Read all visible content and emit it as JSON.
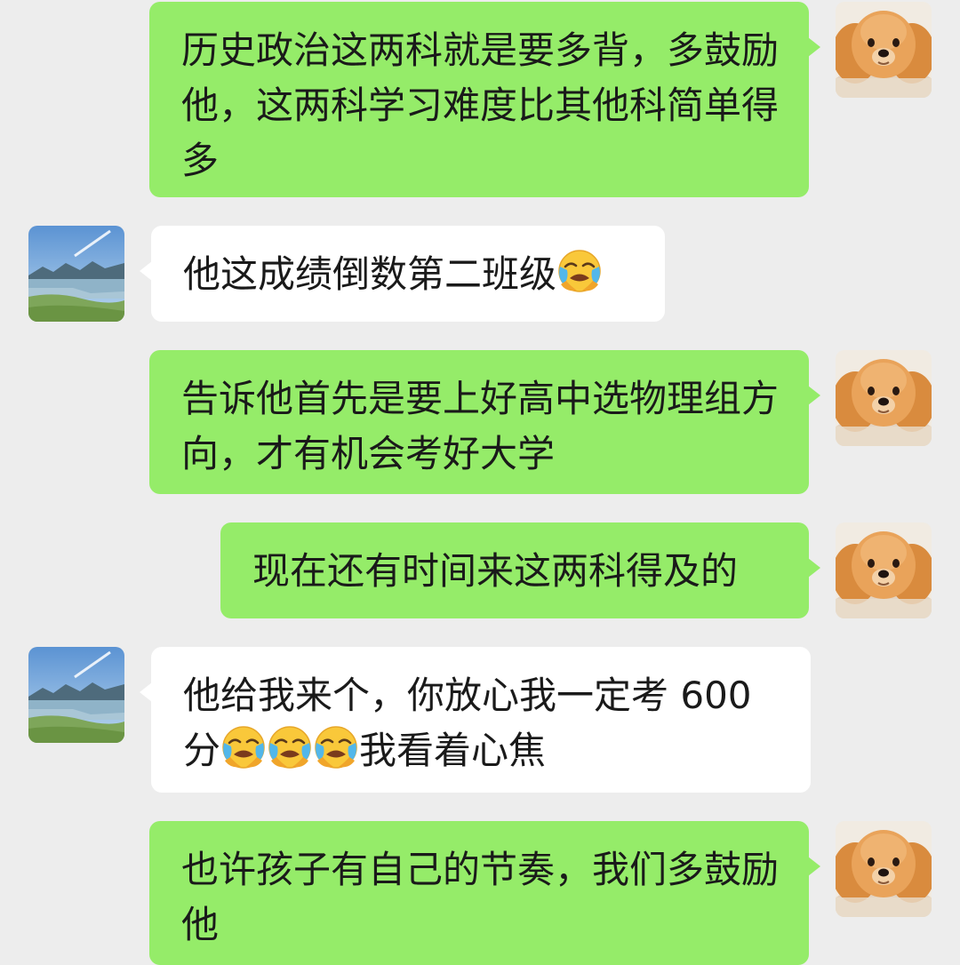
{
  "chat": {
    "messages": [
      {
        "sender": "me",
        "avatar": "pomeranian-dog-avatar",
        "text": "历史政治这两科就是要多背，多鼓励他，这两科学习难度比其他科简单得多"
      },
      {
        "sender": "other",
        "avatar": "lake-landscape-avatar",
        "text": "他这成绩倒数第二班级",
        "emoji_after": "face-with-tears-emoji"
      },
      {
        "sender": "me",
        "avatar": "pomeranian-dog-avatar",
        "text": "告诉他首先是要上好高中选物理组方向，才有机会考好大学"
      },
      {
        "sender": "me",
        "avatar": "pomeranian-dog-avatar",
        "text": "现在还有时间来这两科得及的"
      },
      {
        "sender": "other",
        "avatar": "lake-landscape-avatar",
        "text_before": "他给我来个，你放心我一定考 600 分",
        "emoji_count": 3,
        "emoji": "face-with-tears-emoji",
        "text_after": "我看着心焦"
      },
      {
        "sender": "me",
        "avatar": "pomeranian-dog-avatar",
        "text": "也许孩子有自己的节奏，我们多鼓励他"
      }
    ]
  },
  "colors": {
    "background": "#ededed",
    "sent_bubble": "#95ec69",
    "received_bubble": "#ffffff",
    "text": "#1a1a1a"
  }
}
